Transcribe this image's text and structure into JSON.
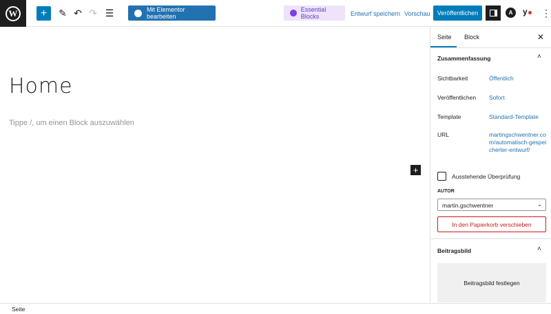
{
  "header": {
    "add_icon": "plus-icon",
    "elementor_label": "Mit Elementor bearbeiten",
    "essential_blocks_label": "Essential Blocks",
    "save_draft": "Entwurf speichern",
    "preview": "Vorschau",
    "publish": "Veröffentlichen",
    "yoast_label": "y"
  },
  "editor": {
    "title": "Home",
    "placeholder": "Tippe /, um einen Block auszuwählen"
  },
  "sidebar": {
    "tabs": [
      "Seite",
      "Block"
    ],
    "summary_title": "Zusammenfassung",
    "rows": [
      {
        "label": "Sichtbarkeit",
        "value": "Öffentlich"
      },
      {
        "label": "Veröffentlichen",
        "value": "Sofort"
      },
      {
        "label": "Template",
        "value": "Standard-Template"
      },
      {
        "label": "URL",
        "value": "martingschwentner.com/automatisch-gespeicherter-entwurf/"
      }
    ],
    "pending_review": "Ausstehende Überprüfung",
    "author_label": "AUTOR",
    "author_value": "martin.gschwentner",
    "trash": "In den Papierkorb verschieben",
    "featured_title": "Beitragsbild",
    "featured_button": "Beitragsbild festlegen"
  },
  "footer": {
    "breadcrumb": "Seite"
  },
  "colors": {
    "accent": "#007cba",
    "danger": "#cc1818"
  }
}
